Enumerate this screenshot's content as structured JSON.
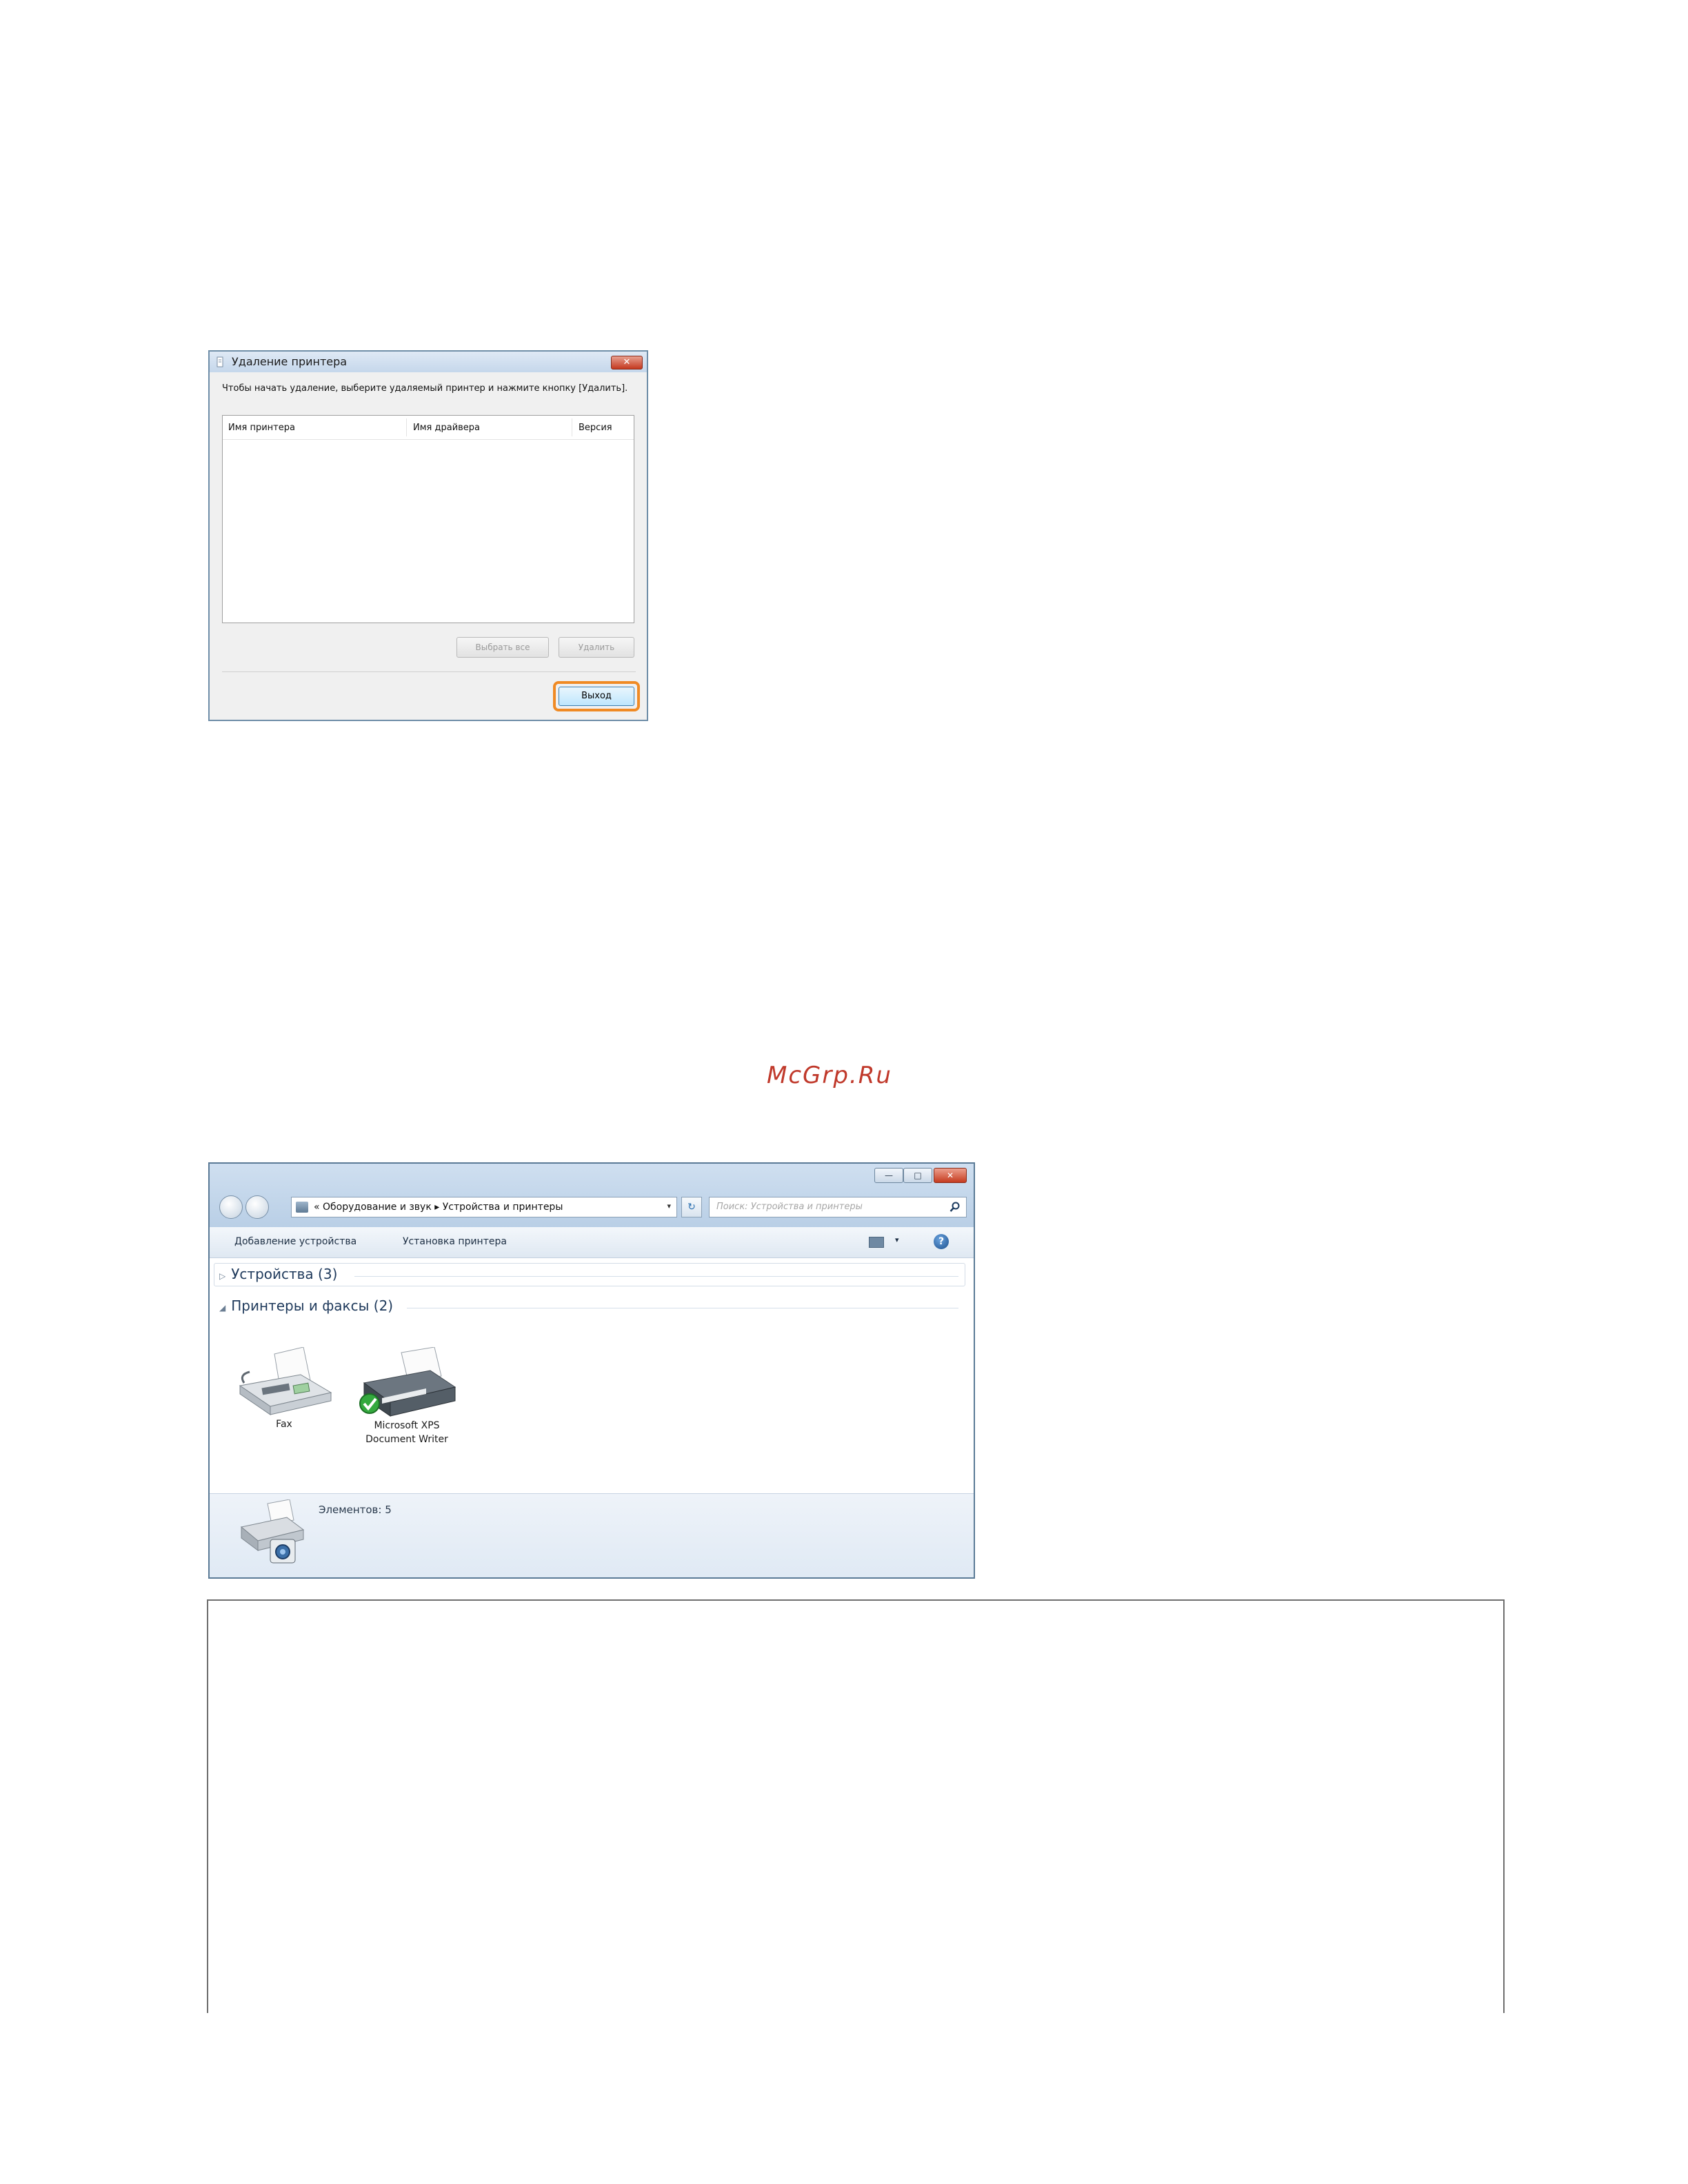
{
  "dialog1": {
    "title": "Удаление принтера",
    "close_label": "✕",
    "instruction": "Чтобы начать удаление, выберите удаляемый принтер и нажмите кнопку [Удалить].",
    "columns": [
      "Имя принтера",
      "Имя драйвера",
      "Версия"
    ],
    "buttons": {
      "select_all": "Выбрать все",
      "delete": "Удалить",
      "exit": "Выход"
    },
    "highlight_color": "#f08a24"
  },
  "watermark": "McGrp.Ru",
  "window2": {
    "window_buttons": {
      "minimize": "—",
      "maximize": "□",
      "close": "✕"
    },
    "address": {
      "prefix": "«",
      "crumb1": "Оборудование и звук",
      "sep": "▸",
      "crumb2": "Устройства и принтеры",
      "dropdown": "▾"
    },
    "refresh_label": "↻",
    "search_placeholder": "Поиск: Устройства и принтеры",
    "toolbar": {
      "add_device": "Добавление устройства",
      "install_printer": "Установка принтера",
      "view_dropdown": "▾",
      "help": "?"
    },
    "groups": {
      "devices": {
        "arrow": "▷",
        "label": "Устройства (3)"
      },
      "printers": {
        "arrow": "◢",
        "label": "Принтеры и факсы (2)"
      }
    },
    "devices": [
      {
        "label": "Fax"
      },
      {
        "label": "Microsoft XPS Document Writer"
      }
    ],
    "details": {
      "count_text": "Элементов: 5"
    }
  }
}
